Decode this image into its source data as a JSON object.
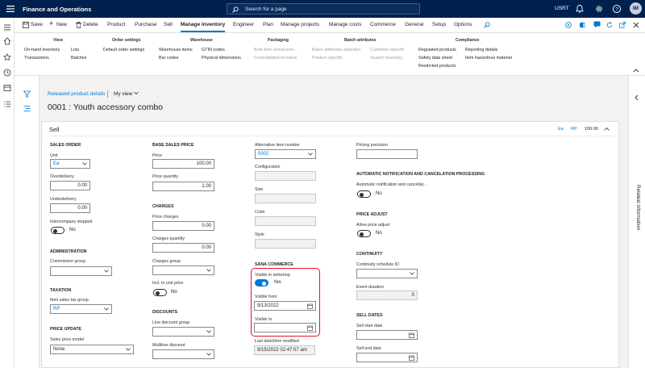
{
  "app": {
    "name": "Finance and Operations",
    "search_placeholder": "Search for a page",
    "company": "USRT",
    "avatar": "IM"
  },
  "actions": {
    "save": "Save",
    "new": "New",
    "delete": "Delete",
    "tabs": [
      "Product",
      "Purchase",
      "Sell",
      "Manage inventory",
      "Engineer",
      "Plan",
      "Manage projects",
      "Manage costs",
      "Commerce",
      "General",
      "Setup",
      "Options"
    ],
    "active_tab": "Manage inventory"
  },
  "ribbon": {
    "groups": {
      "view": {
        "title": "View",
        "items": [
          "On-hand inventory",
          "Lots",
          "Transactions",
          "Batches"
        ]
      },
      "order_settings": {
        "title": "Order settings",
        "items": [
          "Default order settings"
        ]
      },
      "warehouse": {
        "title": "Warehouse",
        "items": [
          "Warehouse items",
          "GTIN codes",
          "Bar codes",
          "Physical dimensions"
        ]
      },
      "packaging": {
        "title": "Packaging",
        "items": [
          "Bulk item conversion",
          "Consolidated on-hand"
        ]
      },
      "batch_attributes": {
        "title": "Batch attributes",
        "items": [
          "Batch attributes selection",
          "Customer specific",
          "Product specific",
          "Search inventory"
        ]
      },
      "compliance": {
        "title": "Compliance",
        "items": [
          "Regulated products",
          "Reporting details",
          "Safety data sheet",
          "Item hazardous material",
          "Restricted products"
        ]
      }
    }
  },
  "page": {
    "breadcrumb": "Released product details",
    "view": "My view",
    "title": "0001 : Youth accessory combo"
  },
  "card": {
    "title": "Sell",
    "summary": [
      "Ea",
      "RP",
      "100.00"
    ]
  },
  "sell": {
    "sales_order": {
      "title": "SALES ORDER",
      "unit_label": "Unit",
      "unit": "Ea",
      "overdelivery_label": "Overdelivery",
      "overdelivery": "0.00",
      "underdelivery_label": "Underdelivery",
      "underdelivery": "0.00",
      "intercompany_label": "Intercompany stopped",
      "intercompany": "No"
    },
    "administration": {
      "title": "ADMINISTRATION",
      "commission_label": "Commission group",
      "commission": ""
    },
    "taxation": {
      "title": "TAXATION",
      "tax_label": "Item sales tax group",
      "tax": "RP"
    },
    "price_update": {
      "title": "PRICE UPDATE",
      "model_label": "Sales price model",
      "model": "None"
    },
    "base_price": {
      "title": "BASE SALES PRICE",
      "price_label": "Price",
      "price": "100.00",
      "qty_label": "Price quantity",
      "qty": "1.00"
    },
    "charges": {
      "title": "CHARGES",
      "price_charges_label": "Price charges",
      "price_charges": "0.00",
      "charges_qty_label": "Charges quantity",
      "charges_qty": "0.00",
      "group_label": "Charges group",
      "group": "",
      "incl_label": "Incl. in unit price",
      "incl": "No"
    },
    "discounts": {
      "title": "DISCOUNTS",
      "line_label": "Line discount group",
      "line": "",
      "multiline_label": "Multiline discount",
      "multiline": ""
    },
    "alt": {
      "alt_label": "Alternative item number",
      "alt": "0002",
      "config_label": "Configuration",
      "size_label": "Size",
      "color_label": "Color",
      "style_label": "Style"
    },
    "sana": {
      "title": "SANA COMMERCE",
      "visible_label": "Visible in webshop",
      "visible": "Yes",
      "from_label": "Visible from",
      "from": "9/13/2022",
      "to_label": "Visible to",
      "to": "",
      "modified_label": "Last date/time modified",
      "modified": "9/15/2022 02:47:07 am"
    },
    "pricing": {
      "precision_label": "Pricing precision",
      "precision": ""
    },
    "auto_notif": {
      "title": "AUTOMATIC NOTIFICATION AND CANCELATION PROCESSING",
      "label": "Automatic notification and cancellat...",
      "value": "No"
    },
    "price_adjust": {
      "title": "PRICE ADJUST",
      "label": "Allow price adjust",
      "value": "No"
    },
    "continuity": {
      "title": "CONTINUITY",
      "schedule_label": "Continuity schedule ID",
      "schedule": "",
      "event_label": "Event duration",
      "event": "0"
    },
    "sell_dates": {
      "title": "SELL DATES",
      "start_label": "Sell start date",
      "start": "",
      "end_label": "Sell end date",
      "end": ""
    }
  },
  "right_pane": {
    "label": "Related information"
  }
}
